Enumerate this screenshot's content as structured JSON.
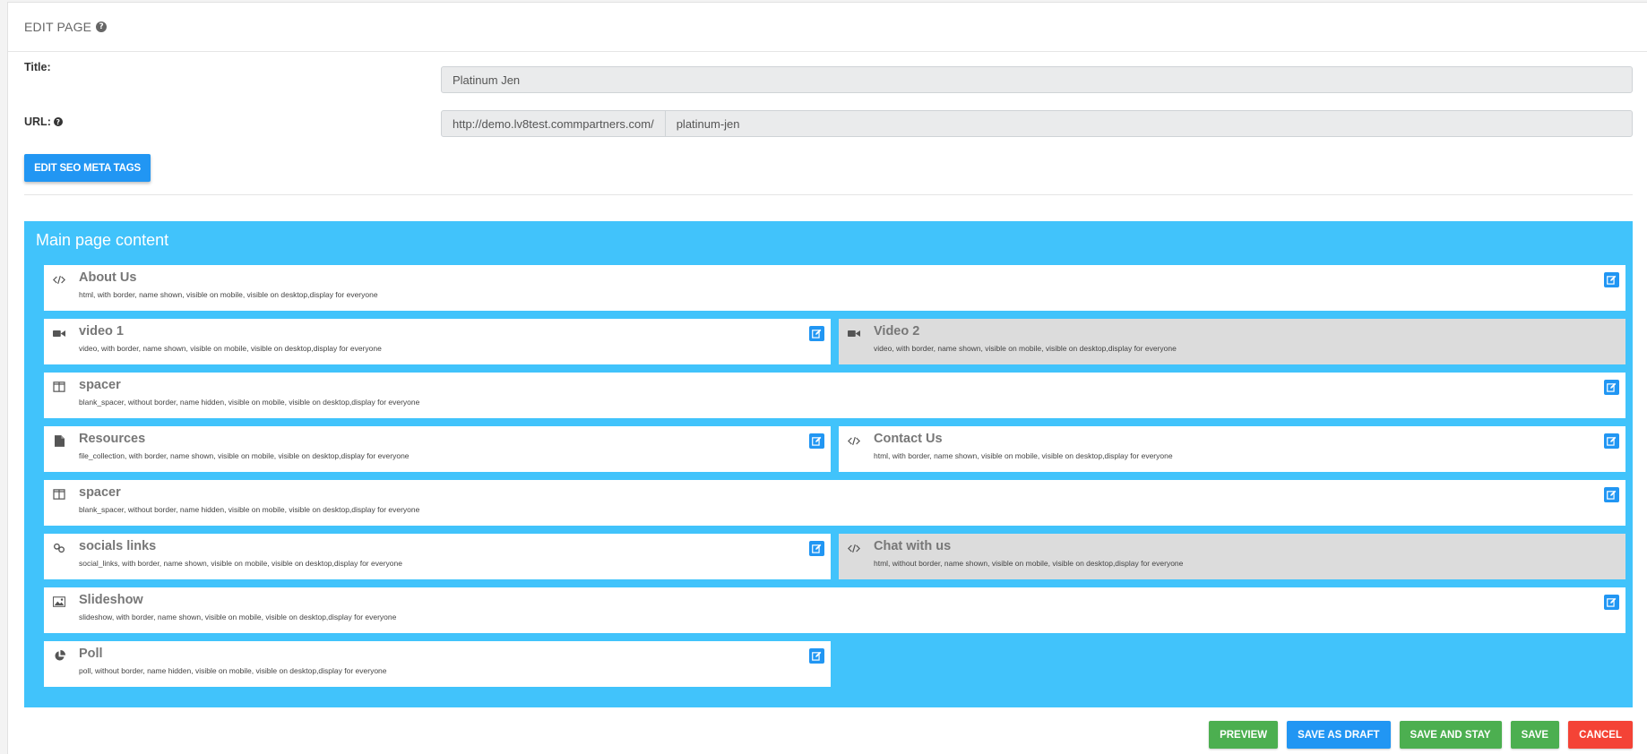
{
  "header": {
    "title": "EDIT PAGE",
    "help_glyph": "?"
  },
  "form": {
    "title_label": "Title:",
    "title_value": "Platinum Jen",
    "url_label": "URL:",
    "url_prefix": "http://demo.lv8test.commpartners.com/",
    "url_value": "platinum-jen",
    "seo_button": "EDIT SEO META TAGS"
  },
  "content": {
    "title": "Main page content",
    "blocks": [
      {
        "name": "About Us",
        "icon": "code-icon",
        "desc": "html, with border, name shown, visible on mobile, visible on desktop,display for everyone",
        "disabled": false,
        "editable": true
      },
      {
        "name": "video 1",
        "icon": "video-camera-icon",
        "desc": "video, with border, name shown, visible on mobile, visible on desktop,display for everyone",
        "disabled": false,
        "editable": true
      },
      {
        "name": "Video 2",
        "icon": "video-camera-icon",
        "desc": "video, with border, name shown, visible on mobile, visible on desktop,display for everyone",
        "disabled": true,
        "editable": false
      },
      {
        "name": "spacer",
        "icon": "columns-icon",
        "desc": "blank_spacer, without border, name hidden, visible on mobile, visible on desktop,display for everyone",
        "disabled": false,
        "editable": true
      },
      {
        "name": "Resources",
        "icon": "file-icon",
        "desc": "file_collection, with border, name shown, visible on mobile, visible on desktop,display for everyone",
        "disabled": false,
        "editable": true
      },
      {
        "name": "Contact Us",
        "icon": "code-icon",
        "desc": "html, with border, name shown, visible on mobile, visible on desktop,display for everyone",
        "disabled": false,
        "editable": true
      },
      {
        "name": "spacer",
        "icon": "columns-icon",
        "desc": "blank_spacer, without border, name hidden, visible on mobile, visible on desktop,display for everyone",
        "disabled": false,
        "editable": true
      },
      {
        "name": "socials links",
        "icon": "link-icon",
        "desc": "social_links, with border, name shown, visible on mobile, visible on desktop,display for everyone",
        "disabled": false,
        "editable": true
      },
      {
        "name": "Chat with us",
        "icon": "code-icon",
        "desc": "html, without border, name shown, visible on mobile, visible on desktop,display for everyone",
        "disabled": true,
        "editable": false
      },
      {
        "name": "Slideshow",
        "icon": "image-icon",
        "desc": "slideshow, with border, name shown, visible on mobile, visible on desktop,display for everyone",
        "disabled": false,
        "editable": true
      },
      {
        "name": "Poll",
        "icon": "pie-chart-icon",
        "desc": "poll, without border, name hidden, visible on mobile, visible on desktop,display for everyone",
        "disabled": false,
        "editable": true
      }
    ]
  },
  "actions": {
    "preview": "PREVIEW",
    "save_draft": "SAVE AS DRAFT",
    "save_stay": "SAVE AND STAY",
    "save": "SAVE",
    "cancel": "CANCEL"
  },
  "colors": {
    "content_bg": "#41c3fb",
    "primary": "#2196f3",
    "success": "#4caf50",
    "danger": "#f44336",
    "disabled_block": "#dcdcdc"
  }
}
